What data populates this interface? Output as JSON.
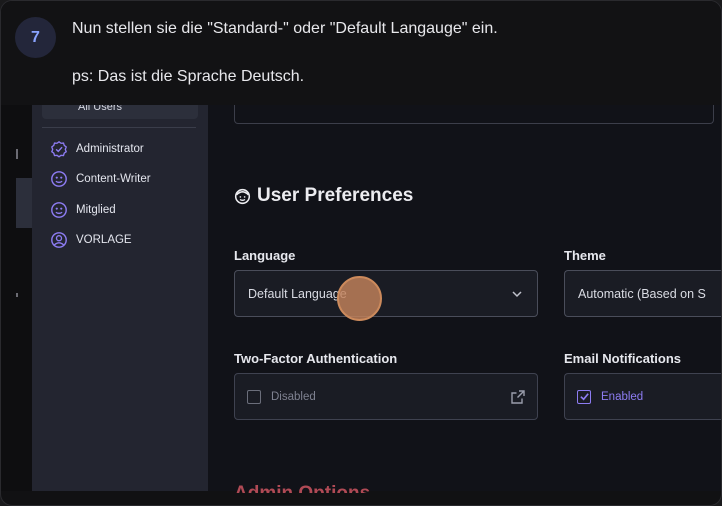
{
  "step": {
    "number": "7",
    "instruction": "Nun stellen sie die \"Standard-\" oder \"Default Langauge\" ein.",
    "note": "ps: Das ist die Sprache Deutsch."
  },
  "sidebar": {
    "selected_label": "All Users",
    "items": [
      {
        "label": "Administrator",
        "icon": "shield-check-icon"
      },
      {
        "label": "Content-Writer",
        "icon": "user-face-icon"
      },
      {
        "label": "Mitglied",
        "icon": "user-face-icon"
      },
      {
        "label": "VORLAGE",
        "icon": "user-circle-icon"
      }
    ]
  },
  "preferences": {
    "title": "User Preferences",
    "language_label": "Language",
    "language_value": "Default Language",
    "theme_label": "Theme",
    "theme_value": "Automatic (Based on S",
    "two_factor_label": "Two-Factor Authentication",
    "two_factor_value": "Disabled",
    "email_label": "Email Notifications",
    "email_value": "Enabled"
  },
  "next_section_title": "Admin Options",
  "colors": {
    "accent": "#8d7cf2",
    "badge_text": "#8aa4ff",
    "cursor": "#cc8a5c",
    "danger": "#b04a55"
  }
}
